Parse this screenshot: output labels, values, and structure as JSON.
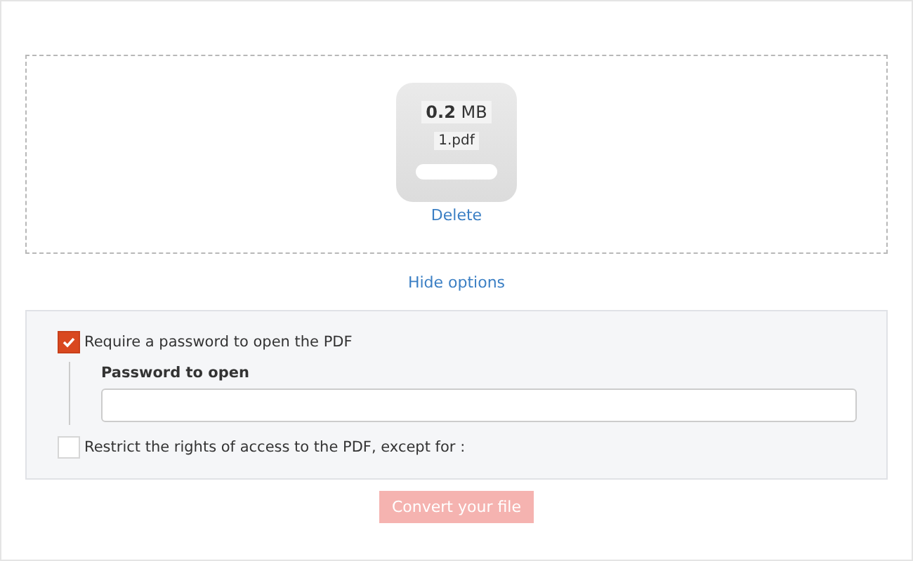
{
  "file": {
    "size": "**0.2** MB",
    "name": "1.pdf",
    "delete": "Delete"
  },
  "options_toggle": "Hide options",
  "options": [
    {
      "kind": "password",
      "label": "Require a password to open the PDF",
      "checked": true,
      "field_label": "Password to open"
    },
    {
      "kind": "plain",
      "label": "Restrict the rights of access to the PDF, except for :",
      "checked": false
    }
  ],
  "convert_button": {
    "label": "Convert your file",
    "disabled": true
  }
}
